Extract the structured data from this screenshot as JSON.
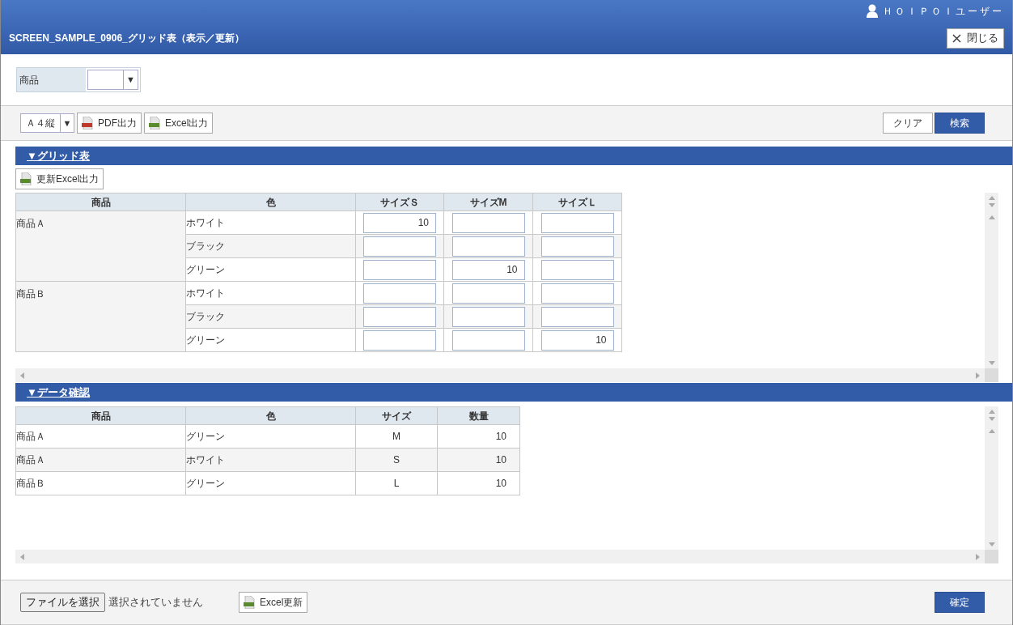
{
  "header": {
    "user_name": "ＨＯＩＰＯＩユーザー",
    "title": "SCREEN_SAMPLE_0906_グリッド表（表示／更新）",
    "close_label": "閉じる"
  },
  "filter": {
    "label": "商品",
    "select_arrow": "▼"
  },
  "toolbar": {
    "paper_select": "Ａ４縦",
    "select_arrow": "▼",
    "exports": [
      {
        "kind": "pdf",
        "label": "PDF出力"
      },
      {
        "kind": "excel",
        "label": "Excel出力"
      }
    ],
    "clear_label": "クリア",
    "search_label": "検索"
  },
  "grid_section": {
    "title": "▼グリッド表",
    "export_label": "更新Excel出力",
    "columns": [
      "商品",
      "色",
      "サイズＳ",
      "サイズM",
      "サイズＬ"
    ],
    "groups": [
      {
        "product": "商品Ａ",
        "items": [
          {
            "color_name": "ホワイト",
            "size_s": "10"
          },
          {
            "color_name": "ブラック"
          },
          {
            "color_name": "グリーン",
            "size_m": "10"
          }
        ]
      },
      {
        "product": "商品Ｂ",
        "items": [
          {
            "color_name": "ホワイト"
          },
          {
            "color_name": "ブラック"
          },
          {
            "color_name": "グリーン",
            "size_l": "10"
          }
        ]
      }
    ]
  },
  "confirm_section": {
    "title": "▼データ確認",
    "columns": [
      "商品",
      "色",
      "サイズ",
      "数量"
    ],
    "rows": [
      [
        "商品Ａ",
        "グリーン",
        "M",
        "10"
      ],
      [
        "商品Ａ",
        "ホワイト",
        "S",
        "10"
      ],
      [
        "商品Ｂ",
        "グリーン",
        "L",
        "10"
      ]
    ]
  },
  "footer": {
    "file_button": "ファイルを選択",
    "file_status": "選択されていません",
    "excel_update_label": "Excel更新",
    "confirm_label": "確定"
  }
}
